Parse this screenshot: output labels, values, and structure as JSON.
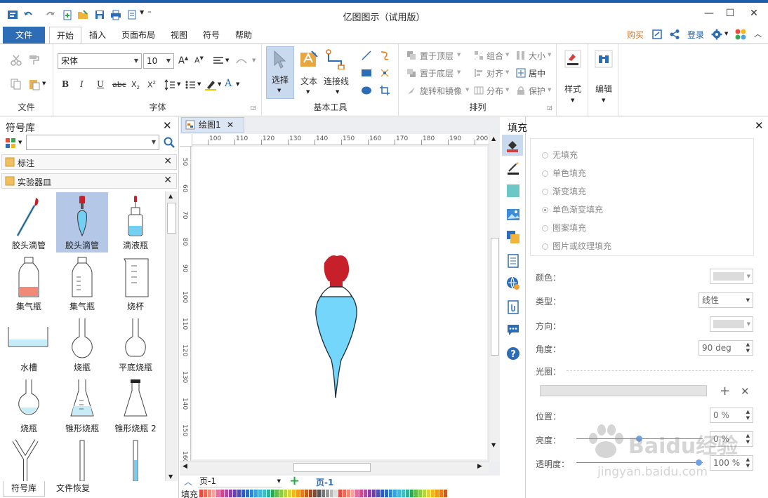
{
  "window": {
    "title": "亿图图示（试用版）"
  },
  "tabs": {
    "file": "文件",
    "home": "开始",
    "insert": "插入",
    "page_layout": "页面布局",
    "view": "视图",
    "symbols": "符号",
    "help": "帮助"
  },
  "header_right": {
    "buy": "购买",
    "login": "登录"
  },
  "ribbon": {
    "file_group": "文件",
    "font_group": "字体",
    "font_name": "宋体",
    "font_size": "10",
    "basic_tools_group": "基本工具",
    "select": "选择",
    "text": "文本",
    "connector": "连接线",
    "arrange_group": "排列",
    "bring_front": "置于顶层",
    "send_back": "置于底层",
    "rotate_mirror": "旋转和镜像",
    "group": "组合",
    "align": "对齐",
    "distribute": "分布",
    "size": "大小",
    "center": "居中",
    "protect": "保护",
    "style": "样式",
    "edit": "编辑"
  },
  "library": {
    "title": "符号库",
    "search_value": "",
    "category1": "标注",
    "category2": "实验器皿",
    "symbols": [
      "胶头滴管",
      "胶头滴管",
      "滴液瓶",
      "集气瓶",
      "集气瓶",
      "烧杯",
      "水槽",
      "烧瓶",
      "平底烧瓶",
      "烧瓶",
      "锥形烧瓶",
      "锥形烧瓶 2"
    ],
    "bottom_tabs": [
      "符号库",
      "文件恢复"
    ]
  },
  "document": {
    "tab": "绘图1",
    "ruler_h": [
      "100",
      "110",
      "120",
      "130",
      "140",
      "150",
      "160",
      "170",
      "180",
      "190",
      "200"
    ],
    "ruler_v": [
      "50",
      "60",
      "70",
      "80",
      "90",
      "100",
      "110",
      "120",
      "130",
      "140",
      "150",
      "160"
    ],
    "page_select": "页-1",
    "page_tab": "页-1",
    "fill_label": "填充"
  },
  "fill_panel": {
    "title": "填充",
    "options": [
      "无填充",
      "单色填充",
      "渐变填充",
      "单色渐变填充",
      "图案填充",
      "图片或纹理填充"
    ],
    "selected_option": "单色渐变填充",
    "color_label": "颜色：",
    "type_label": "类型：",
    "type_value": "线性",
    "direction_label": "方向：",
    "angle_label": "角度：",
    "angle_value": "90 deg",
    "aperture_label": "光圈：",
    "position_label": "位置：",
    "position_value": "0 %",
    "brightness_label": "亮度：",
    "brightness_value": "0 %",
    "transparency_label": "透明度：",
    "transparency_value": "100 %"
  },
  "watermark": {
    "text": "Baidu经验",
    "url": "jingyan.baidu.com"
  },
  "colors": {
    "accent": "#2c6db5",
    "liquid": "#73d0f3",
    "bulb": "#c8202a",
    "selected_bg": "#b4c7e7"
  }
}
